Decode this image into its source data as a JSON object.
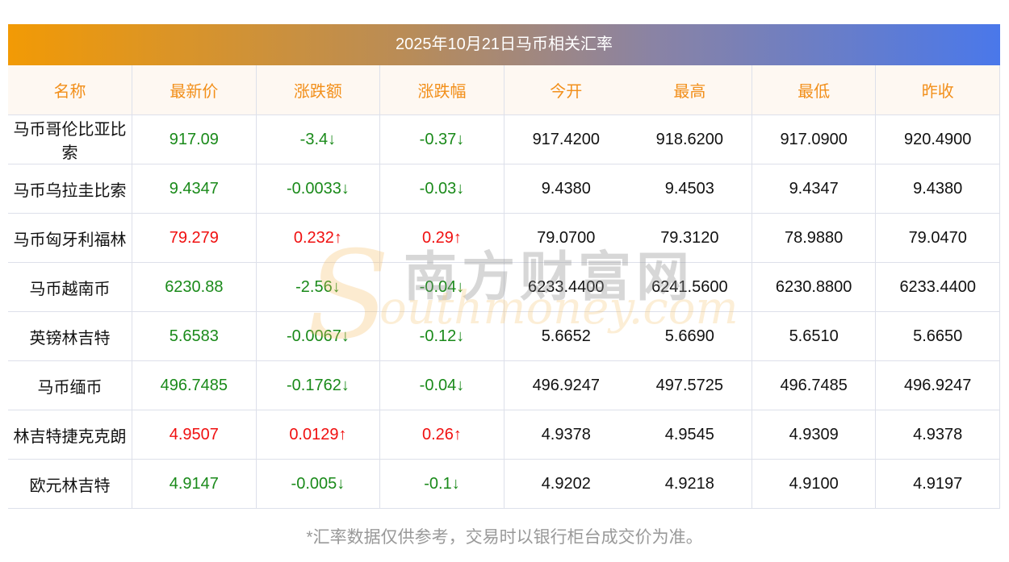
{
  "title": "2025年10月21日马币相关汇率",
  "columns": [
    "名称",
    "最新价",
    "涨跌额",
    "涨跌幅",
    "今开",
    "最高",
    "最低",
    "昨收"
  ],
  "rows": [
    {
      "name": "马币哥伦比亚比索",
      "price": "917.09",
      "change": "-3.4↓",
      "pct": "-0.37↓",
      "open": "917.4200",
      "high": "918.6200",
      "low": "917.0900",
      "prev": "920.4900",
      "dir": "down"
    },
    {
      "name": "马币乌拉圭比索",
      "price": "9.4347",
      "change": "-0.0033↓",
      "pct": "-0.03↓",
      "open": "9.4380",
      "high": "9.4503",
      "low": "9.4347",
      "prev": "9.4380",
      "dir": "down"
    },
    {
      "name": "马币匈牙利福林",
      "price": "79.279",
      "change": "0.232↑",
      "pct": "0.29↑",
      "open": "79.0700",
      "high": "79.3120",
      "low": "78.9880",
      "prev": "79.0470",
      "dir": "up"
    },
    {
      "name": "马币越南币",
      "price": "6230.88",
      "change": "-2.56↓",
      "pct": "-0.04↓",
      "open": "6233.4400",
      "high": "6241.5600",
      "low": "6230.8800",
      "prev": "6233.4400",
      "dir": "down"
    },
    {
      "name": "英镑林吉特",
      "price": "5.6583",
      "change": "-0.0067↓",
      "pct": "-0.12↓",
      "open": "5.6652",
      "high": "5.6690",
      "low": "5.6510",
      "prev": "5.6650",
      "dir": "down"
    },
    {
      "name": "马币缅币",
      "price": "496.7485",
      "change": "-0.1762↓",
      "pct": "-0.04↓",
      "open": "496.9247",
      "high": "497.5725",
      "low": "496.7485",
      "prev": "496.9247",
      "dir": "down"
    },
    {
      "name": "林吉特捷克克朗",
      "price": "4.9507",
      "change": "0.0129↑",
      "pct": "0.26↑",
      "open": "4.9378",
      "high": "4.9545",
      "low": "4.9309",
      "prev": "4.9378",
      "dir": "up"
    },
    {
      "name": "欧元林吉特",
      "price": "4.9147",
      "change": "-0.005↓",
      "pct": "-0.1↓",
      "open": "4.9202",
      "high": "4.9218",
      "low": "4.9100",
      "prev": "4.9197",
      "dir": "down"
    }
  ],
  "watermark": {
    "cn": "南方财富网",
    "en": "outhmoney.com",
    "s": "S"
  },
  "footer": "*汇率数据仅供参考，交易时以银行柜台成交价为准。",
  "colors": {
    "up": "#f01010",
    "down": "#1a8a1a",
    "header_text": "#f28f1a"
  }
}
